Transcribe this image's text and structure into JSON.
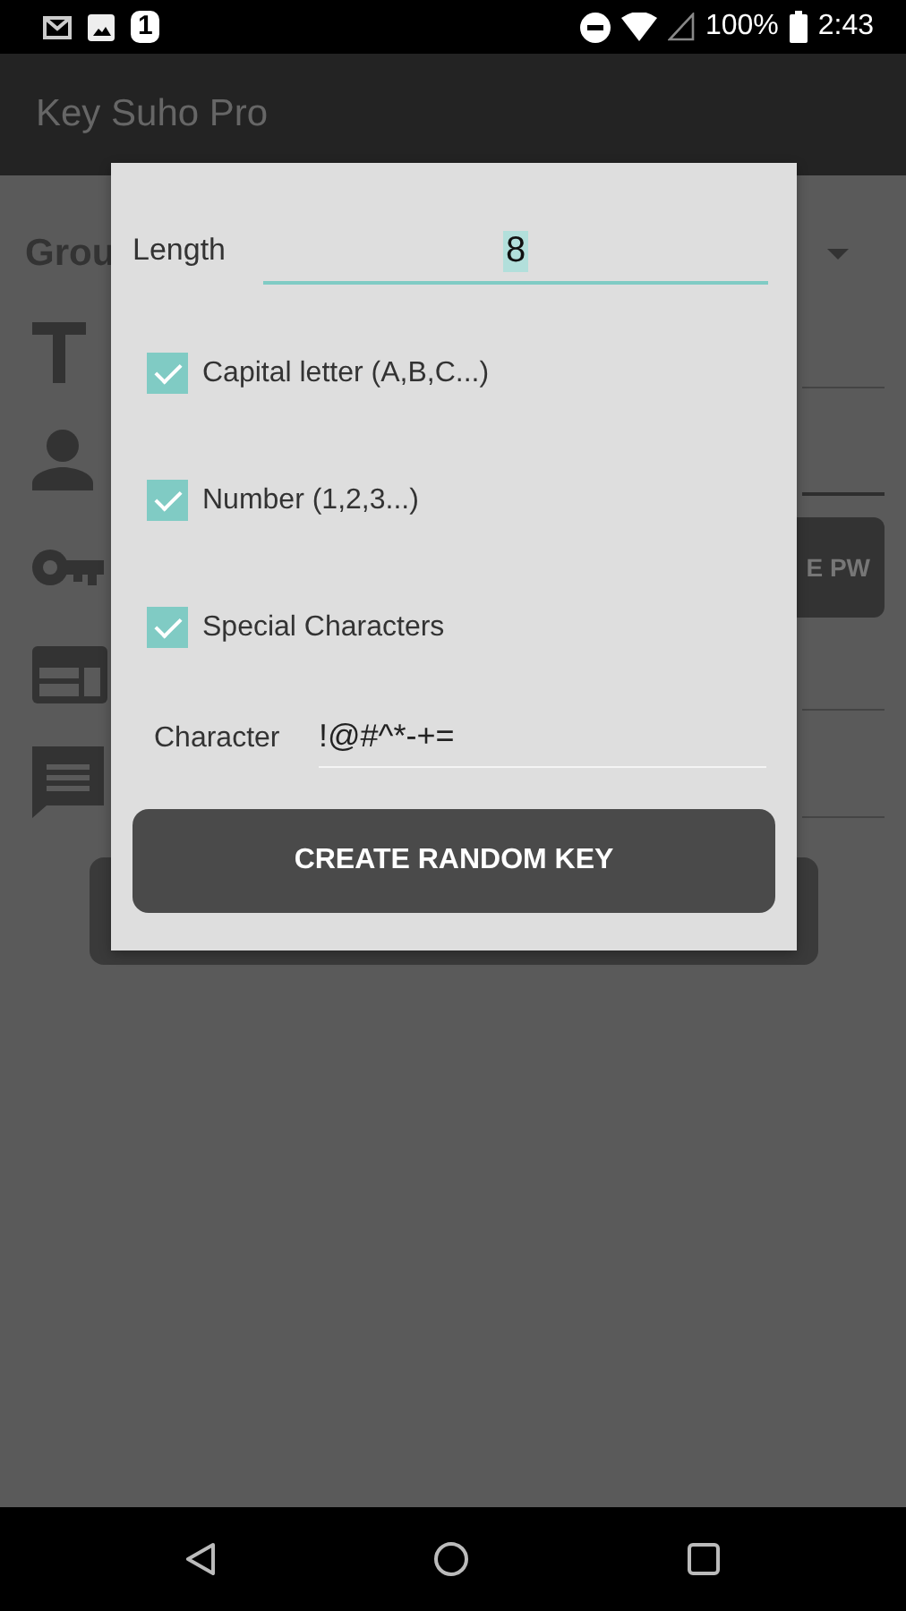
{
  "status_bar": {
    "notification_count": "1",
    "battery": "100%",
    "time": "2:43"
  },
  "app_bar": {
    "title": "Key Suho Pro"
  },
  "background": {
    "group_label": "Grou",
    "generate_button": "E PW"
  },
  "dialog": {
    "length": {
      "label": "Length",
      "value": "8"
    },
    "options": [
      {
        "label": "Capital letter (A,B,C...)",
        "checked": true
      },
      {
        "label": "Number (1,2,3...)",
        "checked": true
      },
      {
        "label": "Special Characters",
        "checked": true
      }
    ],
    "character": {
      "label": "Character",
      "value": "!@#^*-+="
    },
    "button": "CREATE RANDOM KEY"
  }
}
